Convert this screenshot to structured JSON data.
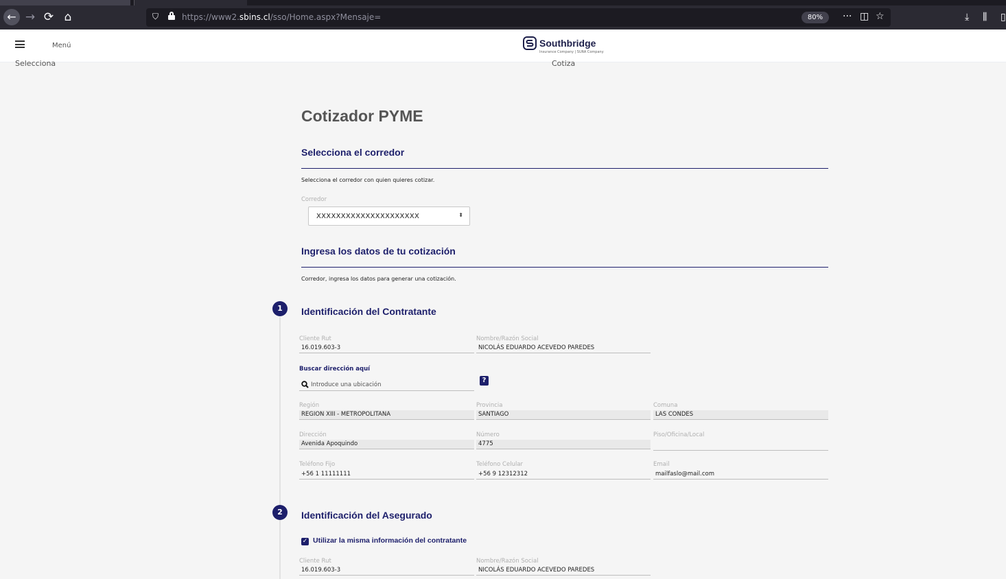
{
  "browser": {
    "url_prefix": "https://www2.",
    "url_host": "sbins.cl",
    "url_path": "/sso/Home.aspx?Mensaje=",
    "zoom": "80%"
  },
  "header": {
    "menu_label": "Menú",
    "brand": "Southbridge",
    "tagline": "Insurance Company | SURA Company",
    "brand_color": "#1d1f4a"
  },
  "breadcrumb": {
    "left": "Selecciona",
    "right": "Cotiza"
  },
  "page": {
    "title": "Cotizador PYME"
  },
  "broker_section": {
    "title": "Selecciona el corredor",
    "note": "Selecciona el corredor con quien quieres cotizar.",
    "select_label": "Corredor",
    "select_value": "XXXXXXXXXXXXXXXXXXXXX"
  },
  "quote_section": {
    "title": "Ingresa los datos de tu cotización",
    "note": "Corredor, ingresa los datos para generar una cotización."
  },
  "step1": {
    "number": "1",
    "title": "Identificación del Contratante",
    "rut_label": "Cliente Rut",
    "rut_value": "16.019.603-3",
    "name_label": "Nombre/Razón Social",
    "name_value": "NICOLÁS EDUARDO ACEVEDO PAREDES",
    "buscar_label": "Buscar dirección aquí",
    "search_placeholder": "Introduce una ubicación",
    "help": "?",
    "region_label": "Región",
    "region_value": "REGION XIII - METROPOLITANA",
    "provincia_label": "Provincia",
    "provincia_value": "SANTIAGO",
    "comuna_label": "Comuna",
    "comuna_value": "LAS CONDES",
    "direccion_label": "Dirección",
    "direccion_value": "Avenida Apoquindo",
    "numero_label": "Número",
    "numero_value": "4775",
    "piso_label": "Piso/Oficina/Local",
    "piso_value": "",
    "fijo_label": "Teléfono Fijo",
    "fijo_value": "+56  1 11111111",
    "celular_label": "Teléfono Celular",
    "celular_value": "+56 9  12312312",
    "email_label": "Email",
    "email_value": "mailfaslo@mail.com"
  },
  "step2": {
    "number": "2",
    "title": "Identificación del Asegurado",
    "same_info_label": "Utilizar la misma información del contratante",
    "same_info_checked": true,
    "rut_label": "Cliente Rut",
    "rut_value": "16.019.603-3",
    "name_label": "Nombre/Razón Social",
    "name_value": "NICOLÁS EDUARDO ACEVEDO PAREDES"
  }
}
